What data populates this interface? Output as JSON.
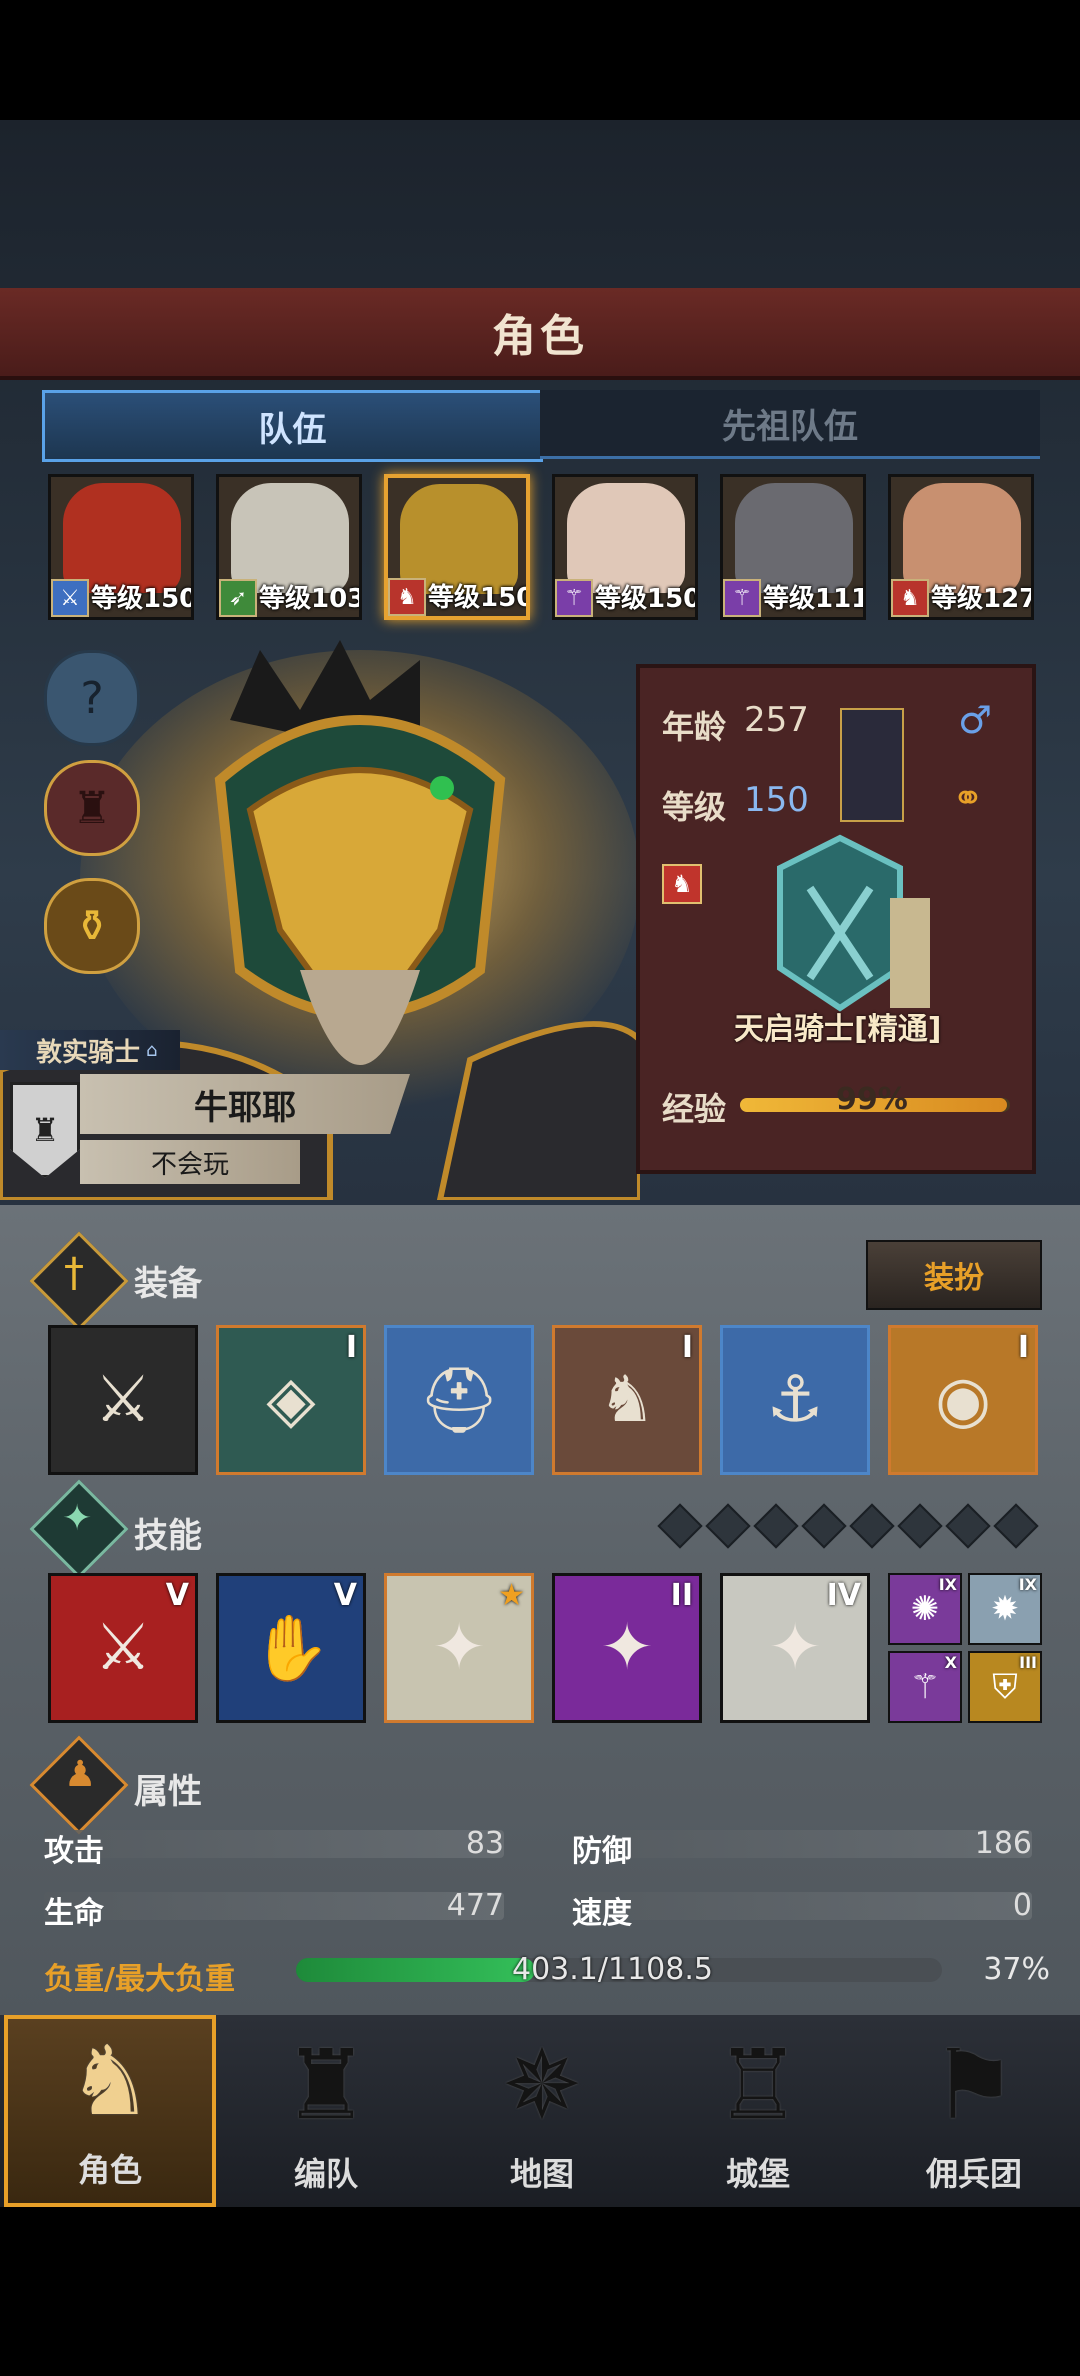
{
  "header": {
    "title": "角色"
  },
  "tabs": [
    {
      "label": "队伍",
      "active": true
    },
    {
      "label": "先祖队伍",
      "active": false
    }
  ],
  "heroes": [
    {
      "level": "等级150",
      "class_icon": "sword-icon",
      "class_color": "#3e6fc0",
      "selected": false,
      "face": "#b03020"
    },
    {
      "level": "等级103",
      "class_icon": "bow-icon",
      "class_color": "#3f8a3a",
      "selected": false,
      "face": "#c8c4b8"
    },
    {
      "level": "等级150",
      "class_icon": "shield-icon",
      "class_color": "#b8342c",
      "selected": true,
      "face": "#b8902c"
    },
    {
      "level": "等级150",
      "class_icon": "staff-icon",
      "class_color": "#7a3ea8",
      "selected": false,
      "face": "#e0c8b8"
    },
    {
      "level": "等级111",
      "class_icon": "staff-icon",
      "class_color": "#7a3ea8",
      "selected": false,
      "face": "#6a6a70"
    },
    {
      "level": "等级127",
      "class_icon": "shield-icon",
      "class_color": "#b8342c",
      "selected": false,
      "face": "#c89070"
    }
  ],
  "side_buttons": [
    {
      "icon": "question-icon",
      "glyph": "?"
    },
    {
      "icon": "figure-icon",
      "glyph": "♜"
    },
    {
      "icon": "potion-icon",
      "glyph": "⚱"
    }
  ],
  "character": {
    "title": "敦实骑士",
    "name": "牛耶耶",
    "subtitle": "不会玩",
    "age_label": "年龄",
    "age": "257",
    "level_label": "等级",
    "level": "150",
    "class_name": "天启骑士[精通]",
    "exp_label": "经验",
    "exp_percent": "99%",
    "exp_fraction": 0.99
  },
  "equipment": {
    "title": "装备",
    "dress_button": "装扮",
    "slots": [
      {
        "icon": "lance-banner-icon",
        "glyph": "⚔",
        "rank": "",
        "bg": "#2a2a2a",
        "border": "#111"
      },
      {
        "icon": "shield-icon",
        "glyph": "◈",
        "rank": "I",
        "bg": "#2f5a52",
        "border": "#d07a2e"
      },
      {
        "icon": "helmet-icon",
        "glyph": "⛑",
        "rank": "",
        "bg": "#3d6aa8",
        "border": "#4d86c8"
      },
      {
        "icon": "armor-icon",
        "glyph": "♞",
        "rank": "I",
        "bg": "#6a4a3a",
        "border": "#d07a2e"
      },
      {
        "icon": "boots-icon",
        "glyph": "⚓",
        "rank": "",
        "bg": "#3d6aa8",
        "border": "#4d86c8"
      },
      {
        "icon": "amulet-icon",
        "glyph": "◉",
        "rank": "I",
        "bg": "#b87828",
        "border": "#d07a2e"
      }
    ]
  },
  "skills": {
    "title": "技能",
    "list": [
      {
        "icon": "sword-strike-icon",
        "glyph": "⚔",
        "rank": "V",
        "bg": "#a82020"
      },
      {
        "icon": "claw-icon",
        "glyph": "✋",
        "rank": "V",
        "bg": "#20407a"
      },
      {
        "icon": "crystal-hand-icon",
        "glyph": "✦",
        "rank": "★",
        "bg": "#c8c4b0"
      },
      {
        "icon": "crystal-hand-icon",
        "glyph": "✦",
        "rank": "II",
        "bg": "#7a2a9a"
      },
      {
        "icon": "crystal-hand-icon",
        "glyph": "✦",
        "rank": "IV",
        "bg": "#c8c8c0"
      }
    ],
    "small": [
      {
        "icon": "sun-sigil-icon",
        "glyph": "✺",
        "rank": "IX",
        "bg": "#7a3a9a"
      },
      {
        "icon": "burst-icon",
        "glyph": "✹",
        "rank": "IX",
        "bg": "#8aa0b0"
      },
      {
        "icon": "wand-icon",
        "glyph": "⚚",
        "rank": "X",
        "bg": "#7a3a9a"
      },
      {
        "icon": "shield-icon",
        "glyph": "⛨",
        "rank": "III",
        "bg": "#b88820"
      }
    ]
  },
  "attributes": {
    "title": "属性",
    "attack_label": "攻击",
    "attack": "83",
    "defense_label": "防御",
    "defense": "186",
    "hp_label": "生命",
    "hp": "477",
    "speed_label": "速度",
    "speed": "0",
    "load_label": "负重/最大负重",
    "load_value": "403.1/1108.5",
    "load_percent": "37%",
    "load_fraction": 0.37
  },
  "nav": [
    {
      "label": "角色",
      "icon": "knight-icon",
      "glyph": "♞",
      "active": true
    },
    {
      "label": "编队",
      "icon": "formation-icon",
      "glyph": "♜",
      "active": false
    },
    {
      "label": "地图",
      "icon": "compass-map-icon",
      "glyph": "✵",
      "active": false
    },
    {
      "label": "城堡",
      "icon": "castle-icon",
      "glyph": "♖",
      "active": false
    },
    {
      "label": "佣兵团",
      "icon": "mercenary-icon",
      "glyph": "⚑",
      "active": false
    }
  ],
  "colors": {
    "accent_orange": "#e8a028",
    "tab_blue": "#5aa2e8",
    "exp_bar": "#f0b838",
    "load_bar": "#2ea84a"
  }
}
